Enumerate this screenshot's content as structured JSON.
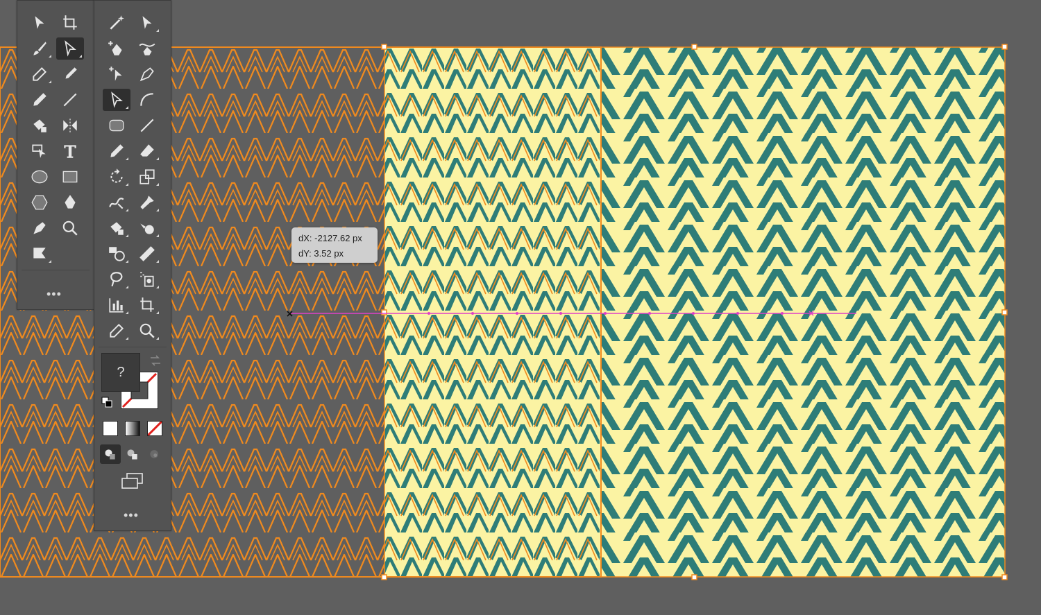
{
  "move_readout": {
    "dx_text": "dX: -2127.62 px",
    "dy_text": "dY: 3.52 px"
  },
  "toolbar_left": {
    "more_label": "•••",
    "tools": [
      "selection-tool",
      "artboard-tool",
      "paintbrush-tool",
      "direct-selection-tool",
      "eyedropper-tool",
      "blob-brush-tool",
      "pencil-tool",
      "line-segment-tool",
      "live-paint-bucket-tool",
      "reflect-tool",
      "perspective-selection-tool",
      "type-tool",
      "ellipse-tool",
      "rectangle-tool",
      "polygon-tool",
      "pen-tool",
      "anchor-point-tool",
      "zoom-tool",
      "flag-tool"
    ]
  },
  "toolbar_right": {
    "more_label": "•••",
    "fill_stroke_label": "?",
    "tools": [
      "magic-wand-tool",
      "direct-selection-tool",
      "add-anchor-point-tool",
      "curvature-pen-tool",
      "add-anchor-point-tool",
      "anchor-point-tool",
      "direct-selection-tool",
      "arc-tool",
      "rounded-rectangle-tool",
      "line-segment-tool",
      "pencil-tool",
      "eraser-tool",
      "rotate-tool",
      "scale-tool",
      "warp-tool",
      "puppet-warp-tool",
      "live-paint-bucket-tool",
      "shape-builder-tool",
      "blend-tool",
      "ruler-tool",
      "lasso-tool",
      "symbol-sprayer-tool",
      "column-graph-tool",
      "artboard-tool",
      "eyedropper-tool",
      "zoom-tool"
    ]
  },
  "colors": {
    "canvas_bg": "#5f5f5f",
    "pattern_outline": "#f08a1e",
    "pattern_fill": "#2e7d78",
    "pattern_bg": "#fbf3a3",
    "guide": "#e040c8",
    "panel_bg": "#535353"
  }
}
